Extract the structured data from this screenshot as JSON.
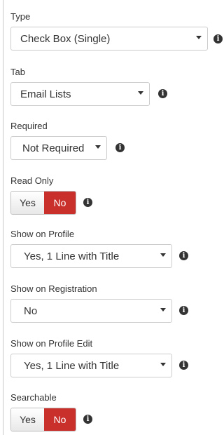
{
  "fields": {
    "type": {
      "label": "Type",
      "value": "Check Box (Single)"
    },
    "tab": {
      "label": "Tab",
      "value": "Email Lists"
    },
    "required": {
      "label": "Required",
      "value": "Not Required"
    },
    "read_only": {
      "label": "Read Only",
      "yes_label": "Yes",
      "no_label": "No",
      "selected": "No"
    },
    "show_on_profile": {
      "label": "Show on Profile",
      "value": "Yes, 1 Line with Title"
    },
    "show_on_registration": {
      "label": "Show on Registration",
      "value": "No"
    },
    "show_on_profile_edit": {
      "label": "Show on Profile Edit",
      "value": "Yes, 1 Line with Title"
    },
    "searchable": {
      "label": "Searchable",
      "yes_label": "Yes",
      "no_label": "No",
      "selected": "No"
    }
  },
  "info_glyph": "i",
  "colors": {
    "toggle_active": "#c9302c",
    "border": "#cccccc"
  },
  "icons": {
    "dropdown": "caret-down-icon",
    "help": "info-circle-icon"
  }
}
